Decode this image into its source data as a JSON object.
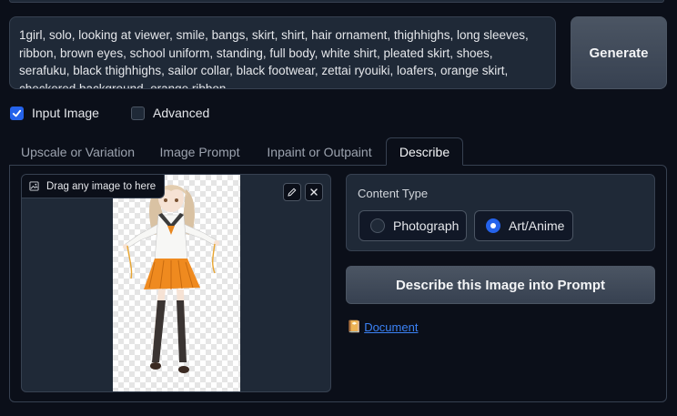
{
  "prompt": {
    "text": "1girl, solo, looking at viewer, smile, bangs, skirt, shirt, hair ornament, thighhighs, long sleeves, ribbon, brown eyes, school uniform, standing, full body, white shirt, pleated skirt, shoes, serafuku, black thighhighs, sailor collar, black footwear, zettai ryouiki, loafers, orange skirt, checkered background, orange ribbon"
  },
  "generate_label": "Generate",
  "options": {
    "input_image": {
      "label": "Input Image",
      "checked": true
    },
    "advanced": {
      "label": "Advanced",
      "checked": false
    }
  },
  "tabs": [
    {
      "label": "Upscale or Variation",
      "active": false
    },
    {
      "label": "Image Prompt",
      "active": false
    },
    {
      "label": "Inpaint or Outpaint",
      "active": false
    },
    {
      "label": "Describe",
      "active": true
    }
  ],
  "image_input": {
    "drop_label": "Drag any image to here",
    "icons": [
      "image-icon",
      "edit-icon",
      "close-icon"
    ]
  },
  "content_type": {
    "label": "Content Type",
    "options": [
      {
        "label": "Photograph",
        "selected": false
      },
      {
        "label": "Art/Anime",
        "selected": true
      }
    ]
  },
  "describe_button": "Describe this Image into Prompt",
  "document_link": {
    "icon": "📔",
    "label": "Document"
  },
  "colors": {
    "background": "#0b0f19",
    "panel": "#1f2937",
    "border": "#374151",
    "accent": "#2563eb",
    "link": "#3b82f6"
  }
}
